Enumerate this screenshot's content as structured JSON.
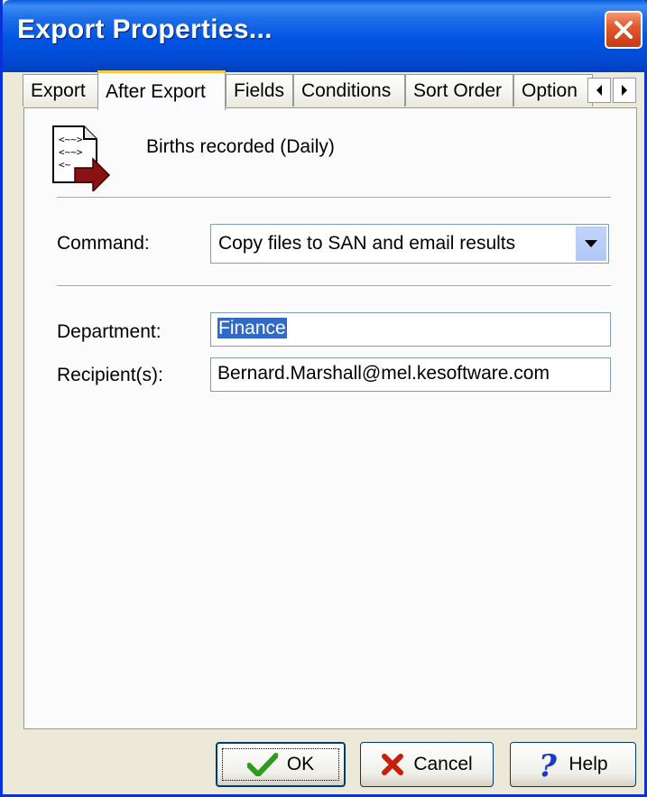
{
  "window": {
    "title": "Export Properties..."
  },
  "tabs": [
    {
      "label": "Export",
      "active": false
    },
    {
      "label": "After Export",
      "active": true
    },
    {
      "label": "Fields",
      "active": false
    },
    {
      "label": "Conditions",
      "active": false
    },
    {
      "label": "Sort Order",
      "active": false
    },
    {
      "label": "Option",
      "active": false
    }
  ],
  "header": {
    "title": "Births recorded (Daily)",
    "icon": "export-document-icon"
  },
  "form": {
    "command_label": "Command:",
    "command_value": "Copy files to SAN and email results",
    "department_label": "Department:",
    "department_value": "Finance",
    "recipients_label": "Recipient(s):",
    "recipients_value": "Bernard.Marshall@mel.kesoftware.com"
  },
  "buttons": {
    "ok_label": "OK",
    "cancel_label": "Cancel",
    "help_label": "Help"
  },
  "colors": {
    "titlebar": "#0054e3",
    "selection": "#316ac5",
    "ok_check": "#2e9a1f",
    "cancel_x": "#c81e0a",
    "help_icon": "#1a3ac8"
  }
}
